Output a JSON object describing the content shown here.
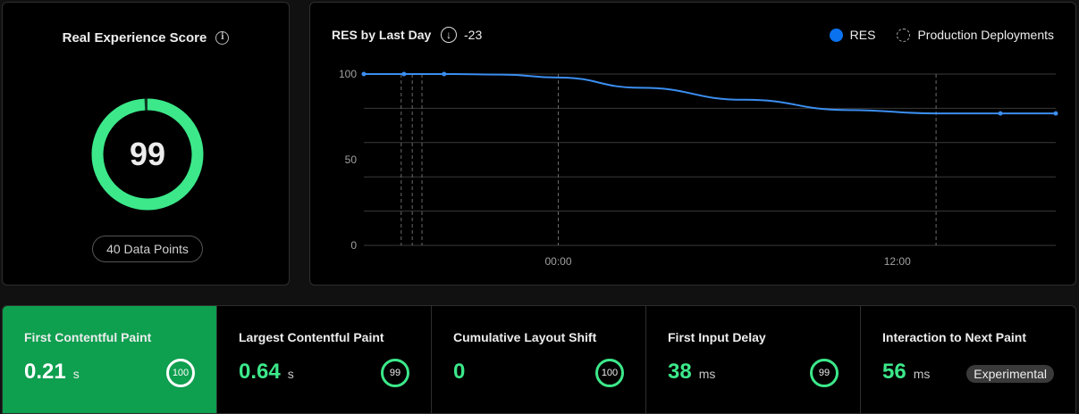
{
  "score": {
    "title": "Real Experience Score",
    "info_icon": "info-icon",
    "value": "99",
    "value_fraction": 0.99,
    "data_points": "40 Data Points",
    "gauge_color": "#3ce88a"
  },
  "chart": {
    "title": "RES by Last Day",
    "delta_icon": "arrow-down-circle-icon",
    "delta": "-23",
    "legend": {
      "res": "RES",
      "deployments": "Production Deployments"
    },
    "res_color": "#0a72ef"
  },
  "chart_data": {
    "type": "line",
    "title": "RES by Last Day",
    "xlabel": "",
    "ylabel": "",
    "y_ticks": [
      "100",
      "50",
      "0"
    ],
    "ylim": [
      0,
      100
    ],
    "x_ticks": [
      {
        "label": "00:00",
        "t": 0.281
      },
      {
        "label": "12:00",
        "t": 0.771
      }
    ],
    "series": [
      {
        "name": "RES",
        "color": "#3b8ef0",
        "points": [
          {
            "t": 0.0,
            "y": 100,
            "marker": true
          },
          {
            "t": 0.058,
            "y": 100,
            "marker": true
          },
          {
            "t": 0.116,
            "y": 100,
            "marker": true
          },
          {
            "t": 0.2,
            "y": 99.7,
            "marker": false
          },
          {
            "t": 0.28,
            "y": 98,
            "marker": false
          },
          {
            "t": 0.4,
            "y": 92,
            "marker": false
          },
          {
            "t": 0.55,
            "y": 85,
            "marker": false
          },
          {
            "t": 0.7,
            "y": 79,
            "marker": false
          },
          {
            "t": 0.83,
            "y": 77,
            "marker": false
          },
          {
            "t": 0.92,
            "y": 77,
            "marker": true
          },
          {
            "t": 1.0,
            "y": 77,
            "marker": true
          }
        ]
      }
    ],
    "deployments_t": [
      0.054,
      0.07,
      0.084,
      0.281,
      0.827
    ],
    "grid": true,
    "legend_position": "top-right"
  },
  "metrics": [
    {
      "label": "First Contentful Paint",
      "value": "0.21",
      "unit": "s",
      "badge": "100",
      "active": true
    },
    {
      "label": "Largest Contentful Paint",
      "value": "0.64",
      "unit": "s",
      "badge": "99",
      "active": false
    },
    {
      "label": "Cumulative Layout Shift",
      "value": "0",
      "unit": "",
      "badge": "100",
      "active": false
    },
    {
      "label": "First Input Delay",
      "value": "38",
      "unit": "ms",
      "badge": "99",
      "active": false
    },
    {
      "label": "Interaction to Next Paint",
      "value": "56",
      "unit": "ms",
      "tag": "Experimental",
      "active": false
    }
  ]
}
